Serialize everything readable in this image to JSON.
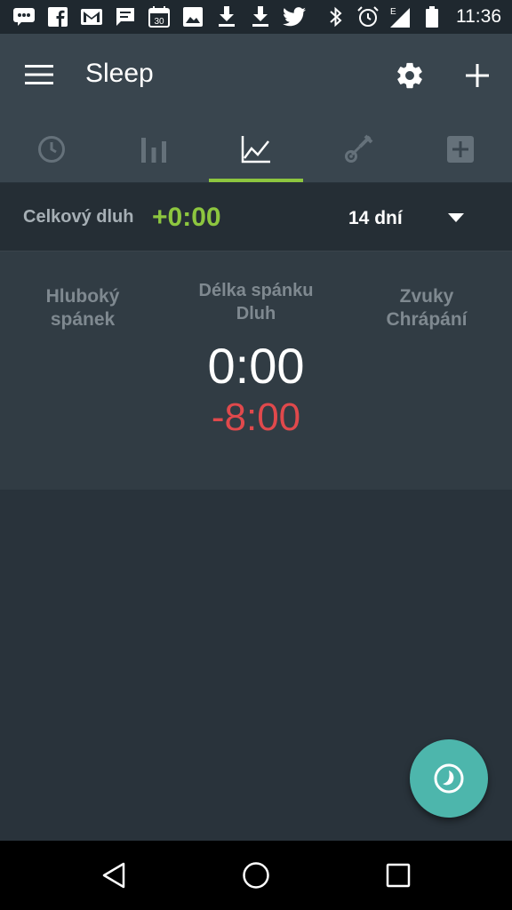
{
  "status_bar": {
    "time": "11:36",
    "left_icons": [
      "messages-icon",
      "facebook-icon",
      "gmail-icon",
      "chat-icon",
      "calendar-icon",
      "image-icon",
      "download-icon",
      "download-icon",
      "twitter-icon"
    ],
    "calendar_day": "30",
    "right_icons": [
      "bluetooth-icon",
      "alarm-icon",
      "signal-icon",
      "battery-icon"
    ],
    "signal_label": "E"
  },
  "app_bar": {
    "title": "Sleep"
  },
  "tabs": [
    {
      "name": "clock-icon",
      "active": false
    },
    {
      "name": "bar-chart-icon",
      "active": false
    },
    {
      "name": "line-chart-icon",
      "active": true
    },
    {
      "name": "stethoscope-icon",
      "active": false
    },
    {
      "name": "add-box-icon",
      "active": false
    }
  ],
  "debt_row": {
    "label": "Celkový dluh",
    "value": "+0:00",
    "period": "14 dní"
  },
  "stats": {
    "left_line1": "Hluboký",
    "left_line2": "spánek",
    "mid_line1": "Délka spánku",
    "mid_line2": "Dluh",
    "right_line1": "Zvuky",
    "right_line2": "Chrápání",
    "duration": "0:00",
    "debt": "-8:00"
  },
  "colors": {
    "accent_green": "#8dc63f",
    "debt_red": "#e0494c",
    "fab": "#4db6ac",
    "app_bar": "#39454e",
    "background": "#29333b"
  }
}
